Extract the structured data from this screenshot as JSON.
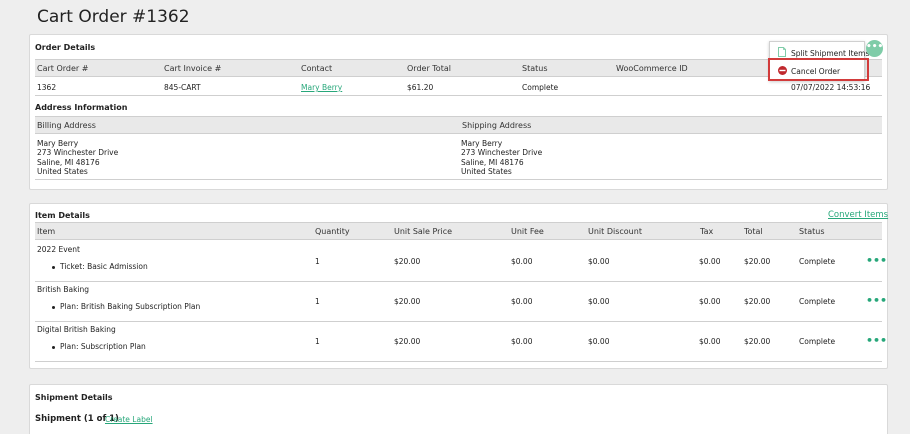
{
  "page": {
    "title": "Cart Order #1362"
  },
  "order_details": {
    "title": "Order Details",
    "headers": [
      "Cart Order #",
      "Cart Invoice #",
      "Contact",
      "Order Total",
      "Status",
      "WooCommerce ID"
    ],
    "row": {
      "cart_order": "1362",
      "cart_invoice": "845-CART",
      "contact": "Mary Berry",
      "order_total": "$61.20",
      "status": "Complete",
      "woocommerce_id": "",
      "date": "07/07/2022 14:53:16"
    }
  },
  "menu": {
    "items": [
      {
        "label": "Split Shipment Items",
        "icon": "document-icon"
      },
      {
        "label": "Cancel Order",
        "icon": "cancel-icon"
      }
    ],
    "more_icon": "ellipsis-icon",
    "cancel_color": "#c0282d",
    "highlight_color": "#d23b3b"
  },
  "address": {
    "title": "Address Information",
    "billing": {
      "label": "Billing Address",
      "lines": [
        "Mary Berry",
        "273 Winchester Drive",
        "Saline, MI 48176",
        "United States"
      ]
    },
    "shipping": {
      "label": "Shipping Address",
      "lines": [
        "Mary Berry",
        "273 Winchester Drive",
        "Saline, MI 48176",
        "United States"
      ]
    }
  },
  "item_details": {
    "title": "Item Details",
    "convert_label": "Convert Items",
    "headers": [
      "Item",
      "Quantity",
      "Unit Sale Price",
      "Unit Fee",
      "Unit Discount",
      "Tax",
      "Total",
      "Status"
    ],
    "rows": [
      {
        "name": "2022 Event",
        "sub": "Ticket: Basic Admission",
        "quantity": "1",
        "unit_sale_price": "$20.00",
        "unit_fee": "$0.00",
        "unit_discount": "$0.00",
        "tax": "$0.00",
        "total": "$20.00",
        "status": "Complete",
        "more": "•••"
      },
      {
        "name": "British Baking",
        "sub": "Plan: British Baking Subscription Plan",
        "quantity": "1",
        "unit_sale_price": "$20.00",
        "unit_fee": "$0.00",
        "unit_discount": "$0.00",
        "tax": "$0.00",
        "total": "$20.00",
        "status": "Complete",
        "more": "•••"
      },
      {
        "name": "Digital British Baking",
        "sub": "Plan: Subscription Plan",
        "quantity": "1",
        "unit_sale_price": "$20.00",
        "unit_fee": "$0.00",
        "unit_discount": "$0.00",
        "tax": "$0.00",
        "total": "$20.00",
        "status": "Complete",
        "more": "•••"
      }
    ]
  },
  "shipment": {
    "title": "Shipment Details",
    "shipment_label": "Shipment (1 of 1)",
    "create_label": "Create Label"
  },
  "colors": {
    "accent": "#27a77a",
    "header_bg": "#e9e9e9"
  }
}
